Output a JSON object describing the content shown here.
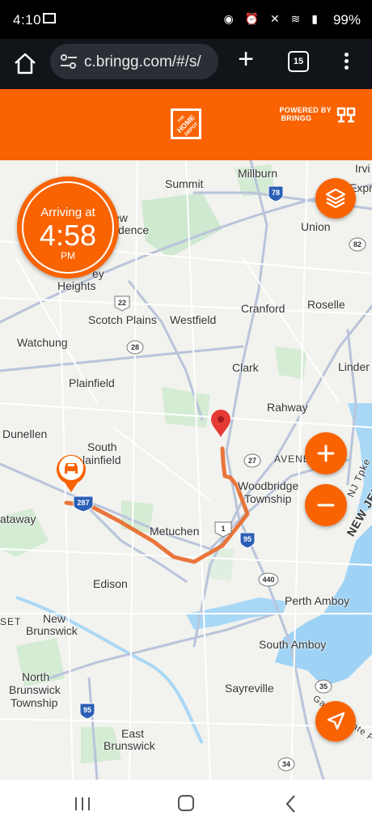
{
  "status_bar": {
    "time": "4:10",
    "battery": "99%",
    "icons": [
      "mail-icon",
      "whatsapp-icon",
      "alarm-icon",
      "mute-icon",
      "wifi-icon",
      "signal-icon"
    ]
  },
  "browser": {
    "url": "c.bringg.com/#/s/",
    "tab_count": "15"
  },
  "header": {
    "logo": "The Home Depot",
    "powered_by": "POWERED BY",
    "powered_brand": "BRINGG",
    "brand_color": "#f96302"
  },
  "eta": {
    "label": "Arriving at",
    "time": "4:58",
    "ampm": "PM"
  },
  "map": {
    "places": [
      {
        "name": "Millburn"
      },
      {
        "name": "Irvi"
      },
      {
        "name": "Summit"
      },
      {
        "name": "Expres"
      },
      {
        "name": "ew"
      },
      {
        "name": "dence"
      },
      {
        "name": "Union"
      },
      {
        "name": "ey"
      },
      {
        "name": "Heights"
      },
      {
        "name": "Scotch Plains"
      },
      {
        "name": "Westfield"
      },
      {
        "name": "Cranford"
      },
      {
        "name": "Roselle"
      },
      {
        "name": "Watchung"
      },
      {
        "name": "Clark"
      },
      {
        "name": "Linder"
      },
      {
        "name": "Plainfield"
      },
      {
        "name": "Rahway"
      },
      {
        "name": "Dunellen"
      },
      {
        "name": "South"
      },
      {
        "name": "lainfield"
      },
      {
        "name": "AVENEL"
      },
      {
        "name": "Woodbridge"
      },
      {
        "name": "Township"
      },
      {
        "name": "NJ Tpke"
      },
      {
        "name": "NEW JERS"
      },
      {
        "name": "ataway"
      },
      {
        "name": "Metuchen"
      },
      {
        "name": "Edison"
      },
      {
        "name": "Perth Amboy"
      },
      {
        "name": "SET"
      },
      {
        "name": "New"
      },
      {
        "name": "Brunswick"
      },
      {
        "name": "South Amboy"
      },
      {
        "name": "North"
      },
      {
        "name": "Brunswick"
      },
      {
        "name": "Township"
      },
      {
        "name": "Sayreville"
      },
      {
        "name": "East"
      },
      {
        "name": "Brunswick"
      },
      {
        "name": "Garden State Pkwy"
      }
    ],
    "shields": [
      "78",
      "82",
      "22",
      "28",
      "27",
      "287",
      "1",
      "95",
      "440",
      "35",
      "95",
      "34"
    ],
    "route_color": "#e86a2c",
    "destination_color": "#e53935"
  },
  "controls": {
    "zoom_in": "+",
    "zoom_out": "−"
  }
}
